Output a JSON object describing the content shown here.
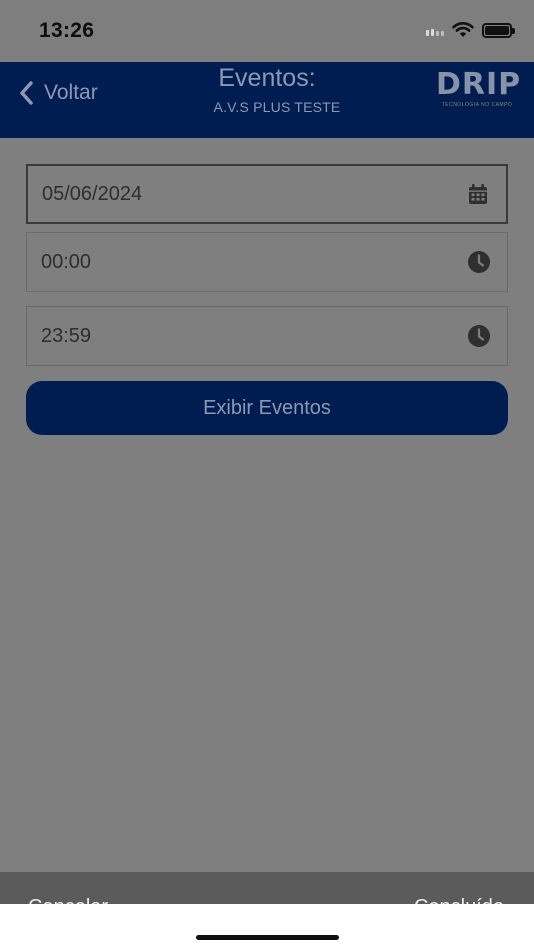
{
  "status_bar": {
    "time": "13:26"
  },
  "header": {
    "back_label": "Voltar",
    "title": "Eventos:",
    "subtitle": "A.V.S PLUS TESTE",
    "logo_text": "DRIP",
    "logo_tagline": "TECNOLOGIA NO CAMPO"
  },
  "form": {
    "date_value": "05/06/2024",
    "start_time_value": "00:00",
    "end_time_value": "23:59",
    "submit_label": "Exibir Eventos"
  },
  "bottom_sheet": {
    "left_label": "Cancelar",
    "right_label": "Concluído"
  },
  "icons": {
    "back": "chevron-left-icon",
    "date": "calendar-icon",
    "time": "clock-icon",
    "wifi": "wifi-icon",
    "battery": "battery-icon",
    "signal": "signal-icon"
  },
  "colors": {
    "header_bg": "#001d52",
    "overlay_bg": "#7f7f7f",
    "button_bg": "#001d52"
  }
}
